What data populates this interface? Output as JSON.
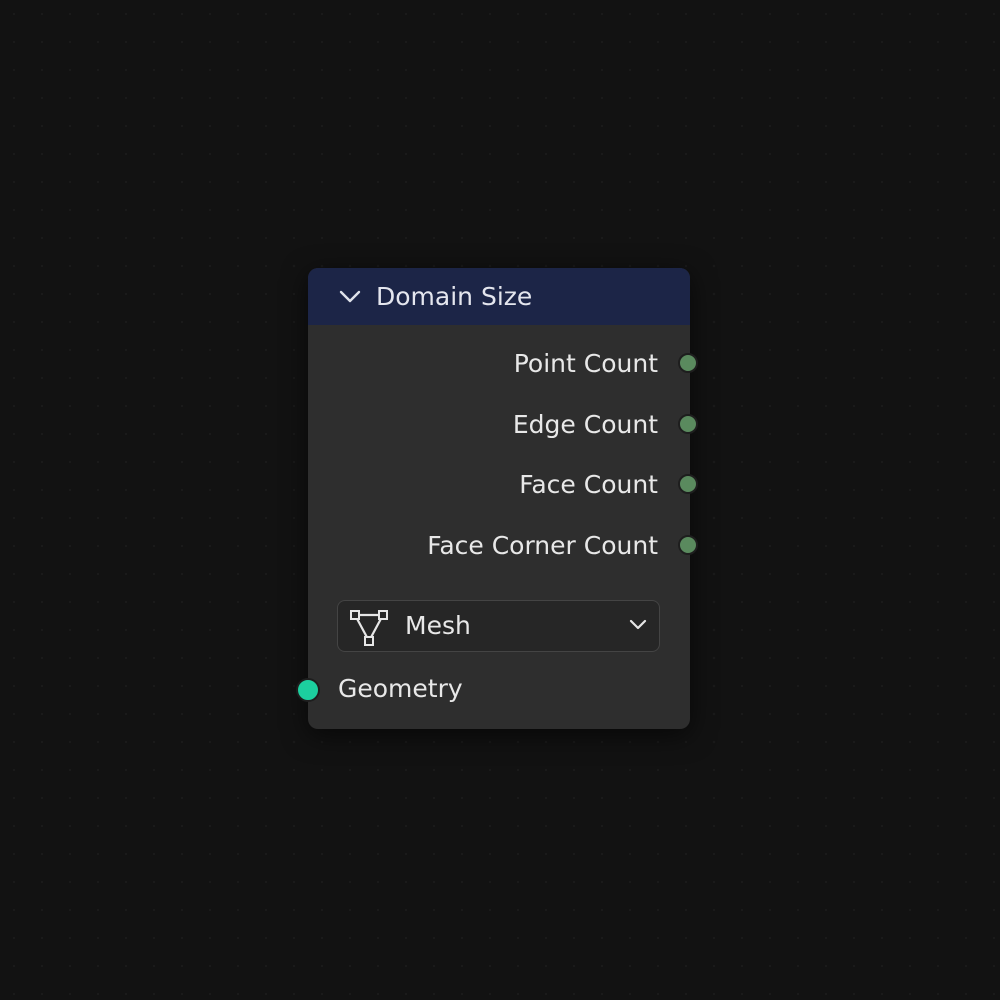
{
  "node": {
    "title": "Domain Size",
    "header_color": "#1c2547",
    "outputs": [
      {
        "label": "Point Count",
        "socket_color": "#5a8a5e"
      },
      {
        "label": "Edge Count",
        "socket_color": "#5a8a5e"
      },
      {
        "label": "Face Count",
        "socket_color": "#5a8a5e"
      },
      {
        "label": "Face Corner Count",
        "socket_color": "#5a8a5e"
      }
    ],
    "component": {
      "value": "Mesh",
      "icon": "mesh-icon"
    },
    "inputs": [
      {
        "label": "Geometry",
        "socket_color": "#1ccf9f"
      }
    ]
  }
}
